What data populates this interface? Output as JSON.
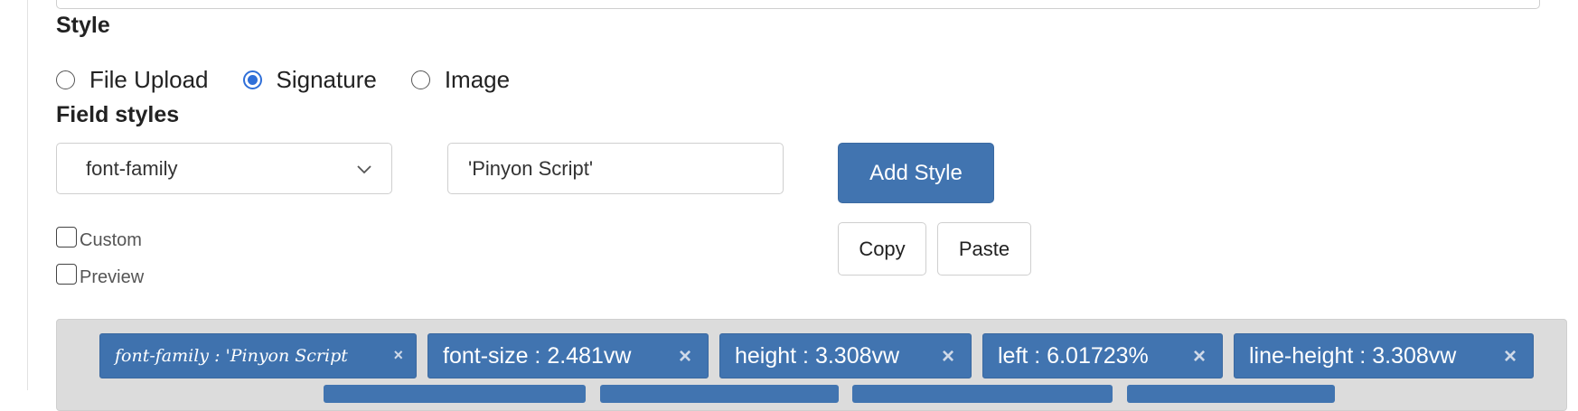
{
  "style_section": {
    "heading": "Style",
    "options": [
      {
        "label": "File Upload",
        "checked": false
      },
      {
        "label": "Signature",
        "checked": true
      },
      {
        "label": "Image",
        "checked": false
      }
    ]
  },
  "field_styles": {
    "heading": "Field styles",
    "property_select": {
      "value": "font-family"
    },
    "value_input": {
      "value": "'Pinyon Script'"
    },
    "add_button": "Add Style",
    "copy_button": "Copy",
    "paste_button": "Paste",
    "custom_checkbox": {
      "label": "Custom",
      "checked": false
    },
    "preview_checkbox": {
      "label": "Preview",
      "checked": false
    },
    "tags": [
      {
        "text": "font-family : 'Pinyon Script",
        "remove": "×"
      },
      {
        "text": "font-size : 2.481vw",
        "remove": "×"
      },
      {
        "text": "height : 3.308vw",
        "remove": "×"
      },
      {
        "text": "left : 6.01723%",
        "remove": "×"
      },
      {
        "text": "line-height : 3.308vw",
        "remove": "×"
      }
    ]
  },
  "colors": {
    "accent": "#4174b0",
    "radio_selected": "#2f6fd8",
    "panel_bg": "#dcdcdc"
  },
  "icons": {
    "select_chevron": "chevron-down-icon",
    "tag_remove": "close-icon"
  }
}
